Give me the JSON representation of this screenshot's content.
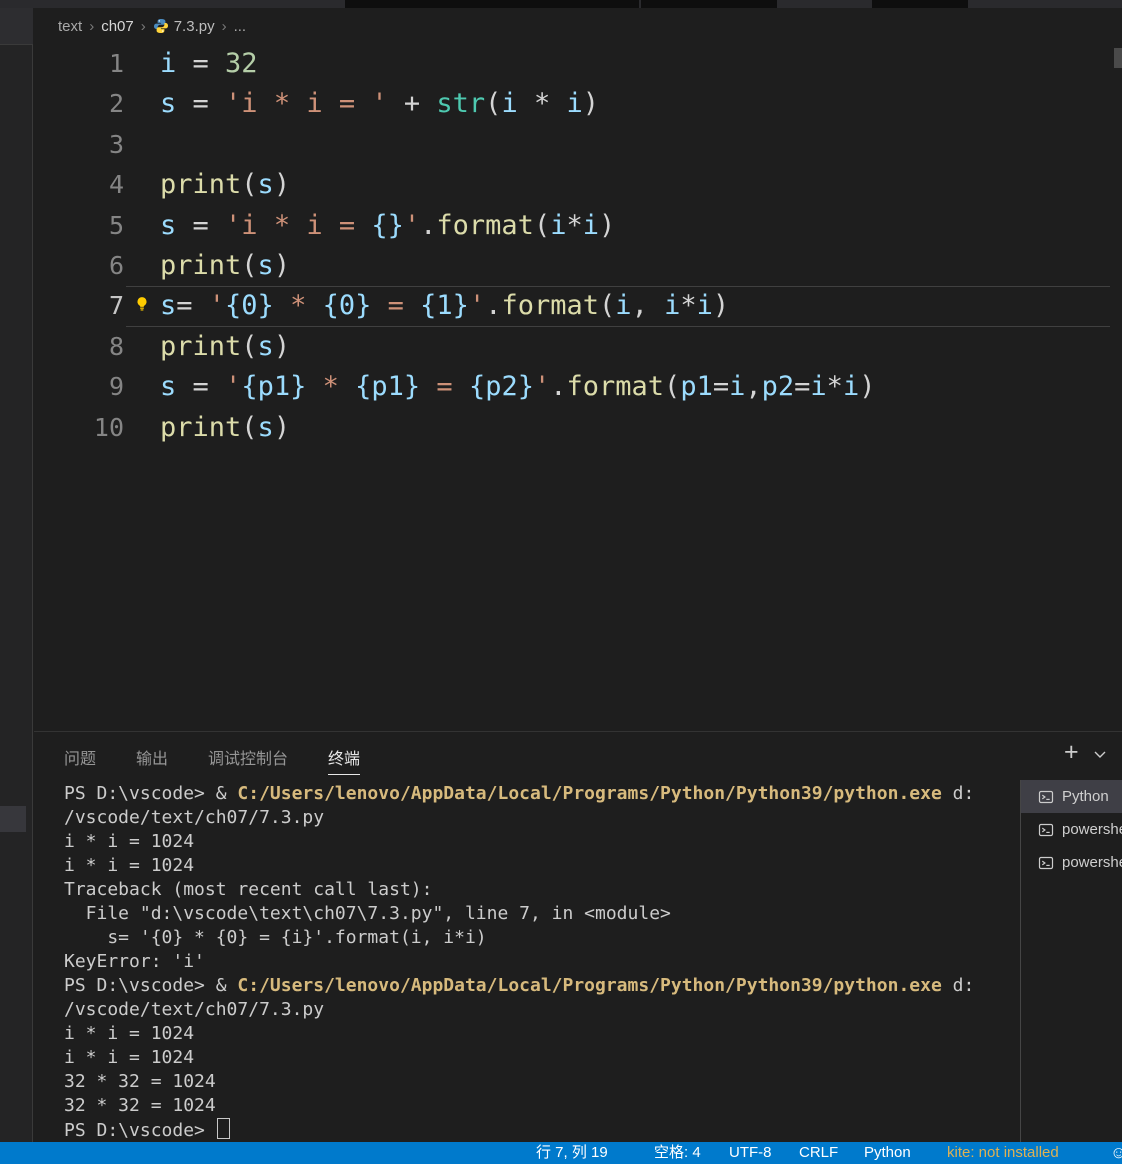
{
  "colors": {
    "statusbar_background": "#007acc",
    "terminal_command_yellow": "#d7ba7d",
    "kite_warning": "#ddb154",
    "editor_background": "#1e1e1e"
  },
  "breadcrumb": {
    "segments": [
      "text",
      "ch07",
      "7.3.py"
    ],
    "more": "...",
    "separator": "›"
  },
  "editor": {
    "active_line": 7,
    "lines": [
      {
        "n": "1",
        "t": [
          [
            "i",
            "v"
          ],
          [
            " = ",
            "d"
          ],
          [
            "32",
            "n"
          ]
        ]
      },
      {
        "n": "2",
        "t": [
          [
            "s",
            "v"
          ],
          [
            " = ",
            "d"
          ],
          [
            "'i * i = '",
            "s"
          ],
          [
            " + ",
            "d"
          ],
          [
            "str",
            "c"
          ],
          [
            "(",
            "d"
          ],
          [
            "i",
            "v"
          ],
          [
            " * ",
            "d"
          ],
          [
            "i",
            "v"
          ],
          [
            ")",
            "d"
          ]
        ]
      },
      {
        "n": "3",
        "t": []
      },
      {
        "n": "4",
        "t": [
          [
            "print",
            "f"
          ],
          [
            "(",
            "d"
          ],
          [
            "s",
            "v"
          ],
          [
            ")",
            "d"
          ]
        ]
      },
      {
        "n": "5",
        "t": [
          [
            "s",
            "v"
          ],
          [
            " = ",
            "d"
          ],
          [
            "'i * i = ",
            "s"
          ],
          [
            "{}",
            "v"
          ],
          [
            "'",
            "s"
          ],
          [
            ".",
            "d"
          ],
          [
            "format",
            "f"
          ],
          [
            "(",
            "d"
          ],
          [
            "i",
            "v"
          ],
          [
            "*",
            "d"
          ],
          [
            "i",
            "v"
          ],
          [
            ")",
            "d"
          ]
        ]
      },
      {
        "n": "6",
        "t": [
          [
            "print",
            "f"
          ],
          [
            "(",
            "d"
          ],
          [
            "s",
            "v"
          ],
          [
            ")",
            "d"
          ]
        ]
      },
      {
        "n": "7",
        "t": [
          [
            "s",
            "v"
          ],
          [
            "= ",
            "d"
          ],
          [
            "'",
            "s"
          ],
          [
            "{0}",
            "v"
          ],
          [
            " * ",
            "s"
          ],
          [
            "{0}",
            "v"
          ],
          [
            " = ",
            "s"
          ],
          [
            "{1}",
            "v"
          ],
          [
            "'",
            "s"
          ],
          [
            ".",
            "d"
          ],
          [
            "format",
            "f"
          ],
          [
            "(",
            "d"
          ],
          [
            "i",
            "v"
          ],
          [
            ", ",
            "d"
          ],
          [
            "i",
            "v"
          ],
          [
            "*",
            "d"
          ],
          [
            "i",
            "v"
          ],
          [
            ")",
            "d"
          ]
        ]
      },
      {
        "n": "8",
        "t": [
          [
            "print",
            "f"
          ],
          [
            "(",
            "d"
          ],
          [
            "s",
            "v"
          ],
          [
            ")",
            "d"
          ]
        ]
      },
      {
        "n": "9",
        "t": [
          [
            "s",
            "v"
          ],
          [
            " = ",
            "d"
          ],
          [
            "'",
            "s"
          ],
          [
            "{p1}",
            "v"
          ],
          [
            " * ",
            "s"
          ],
          [
            "{p1}",
            "v"
          ],
          [
            " = ",
            "s"
          ],
          [
            "{p2}",
            "v"
          ],
          [
            "'",
            "s"
          ],
          [
            ".",
            "d"
          ],
          [
            "format",
            "f"
          ],
          [
            "(",
            "d"
          ],
          [
            "p1",
            "v"
          ],
          [
            "=",
            "d"
          ],
          [
            "i",
            "v"
          ],
          [
            ",",
            "d"
          ],
          [
            "p2",
            "v"
          ],
          [
            "=",
            "d"
          ],
          [
            "i",
            "v"
          ],
          [
            "*",
            "d"
          ],
          [
            "i",
            "v"
          ],
          [
            ")",
            "d"
          ]
        ]
      },
      {
        "n": "10",
        "t": [
          [
            "print",
            "f"
          ],
          [
            "(",
            "d"
          ],
          [
            "s",
            "v"
          ],
          [
            ")",
            "d"
          ]
        ]
      }
    ]
  },
  "panel": {
    "tabs": [
      {
        "label": "问题",
        "active": false
      },
      {
        "label": "输出",
        "active": false
      },
      {
        "label": "调试控制台",
        "active": false
      },
      {
        "label": "终端",
        "active": true
      }
    ],
    "actions": {
      "new_terminal_label": "+"
    }
  },
  "terminal": {
    "lines": [
      {
        "t": [
          [
            "PS D:\\vscode> & ",
            "t"
          ],
          [
            "C:/Users/lenovo/AppData/Local/Programs/Python/Python39/python.exe",
            "y"
          ],
          [
            " d:",
            "t"
          ]
        ]
      },
      {
        "t": [
          [
            "/vscode/text/ch07/7.3.py",
            "t"
          ]
        ]
      },
      {
        "t": [
          [
            "i * i = 1024",
            "t"
          ]
        ]
      },
      {
        "t": [
          [
            "i * i = 1024",
            "t"
          ]
        ]
      },
      {
        "t": [
          [
            "Traceback (most recent call last):",
            "t"
          ]
        ]
      },
      {
        "t": [
          [
            "  File \"d:\\vscode\\text\\ch07\\7.3.py\", line 7, in <module>",
            "t"
          ]
        ]
      },
      {
        "t": [
          [
            "    s= '{0} * {0} = {i}'.format(i, i*i)",
            "t"
          ]
        ]
      },
      {
        "t": [
          [
            "KeyError: 'i'",
            "t"
          ]
        ]
      },
      {
        "t": [
          [
            "PS D:\\vscode> & ",
            "t"
          ],
          [
            "C:/Users/lenovo/AppData/Local/Programs/Python/Python39/python.exe",
            "y"
          ],
          [
            " d:",
            "t"
          ]
        ]
      },
      {
        "t": [
          [
            "/vscode/text/ch07/7.3.py",
            "t"
          ]
        ]
      },
      {
        "t": [
          [
            "i * i = 1024",
            "t"
          ]
        ]
      },
      {
        "t": [
          [
            "i * i = 1024",
            "t"
          ]
        ]
      },
      {
        "t": [
          [
            "32 * 32 = 1024",
            "t"
          ]
        ]
      },
      {
        "t": [
          [
            "32 * 32 = 1024",
            "t"
          ]
        ]
      },
      {
        "t": [
          [
            "PS D:\\vscode> ",
            "t"
          ]
        ],
        "cursor": true
      }
    ]
  },
  "terminal_list": [
    {
      "icon": "terminal-icon",
      "label": "Python",
      "selected": true
    },
    {
      "icon": "terminal-icon",
      "label": "powershell",
      "selected": false
    },
    {
      "icon": "terminal-icon",
      "label": "powershell",
      "selected": false
    }
  ],
  "statusbar": {
    "items": [
      {
        "label": "行 7, 列 19",
        "kind": "cursor-position"
      },
      {
        "label": "空格: 4",
        "kind": "indentation"
      },
      {
        "label": "UTF-8",
        "kind": "encoding"
      },
      {
        "label": "CRLF",
        "kind": "eol"
      },
      {
        "label": "Python",
        "kind": "language"
      },
      {
        "label": "kite: not installed",
        "kind": "kite"
      },
      {
        "label": "☺",
        "kind": "feedback"
      }
    ]
  }
}
